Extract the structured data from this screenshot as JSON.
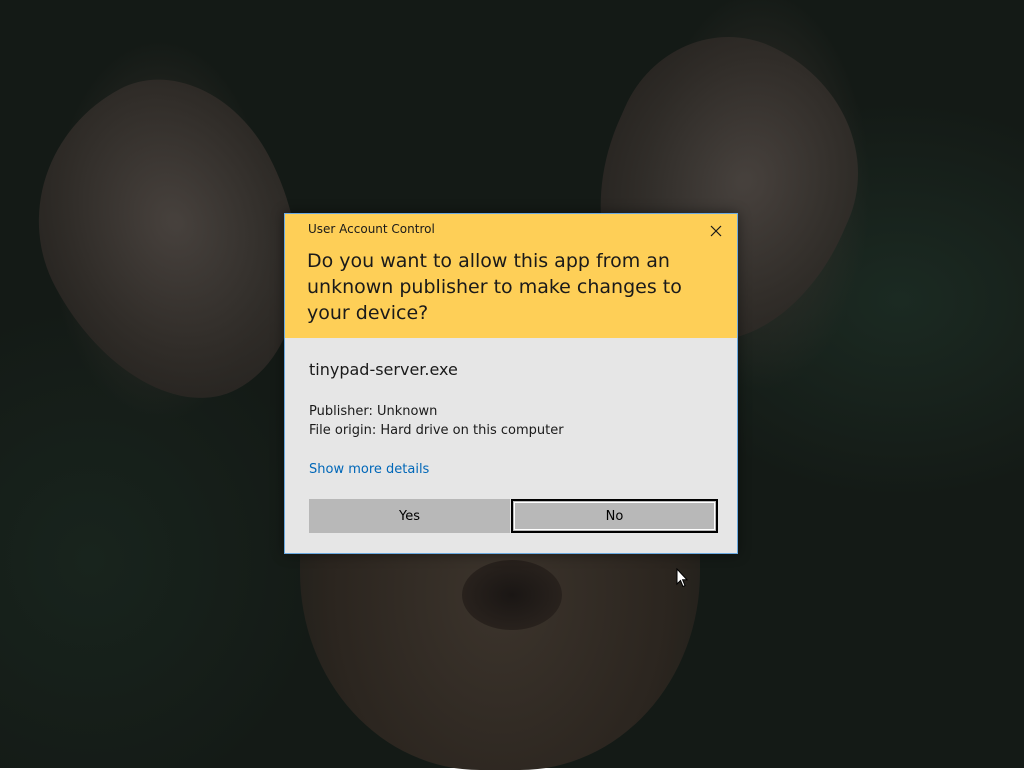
{
  "dialog": {
    "title": "User Account Control",
    "question": "Do you want to allow this app from an unknown publisher to make changes to your device?",
    "app_name": "tinypad-server.exe",
    "publisher": "Publisher: Unknown",
    "file_origin": "File origin: Hard drive on this computer",
    "details_link": "Show more details",
    "yes_label": "Yes",
    "no_label": "No",
    "close_icon": "close-icon"
  },
  "colors": {
    "header_bg": "#fecf57",
    "body_bg": "#e6e6e6",
    "button_bg": "#b8b8b8",
    "link": "#0067b8",
    "border": "#6aa9e0"
  }
}
